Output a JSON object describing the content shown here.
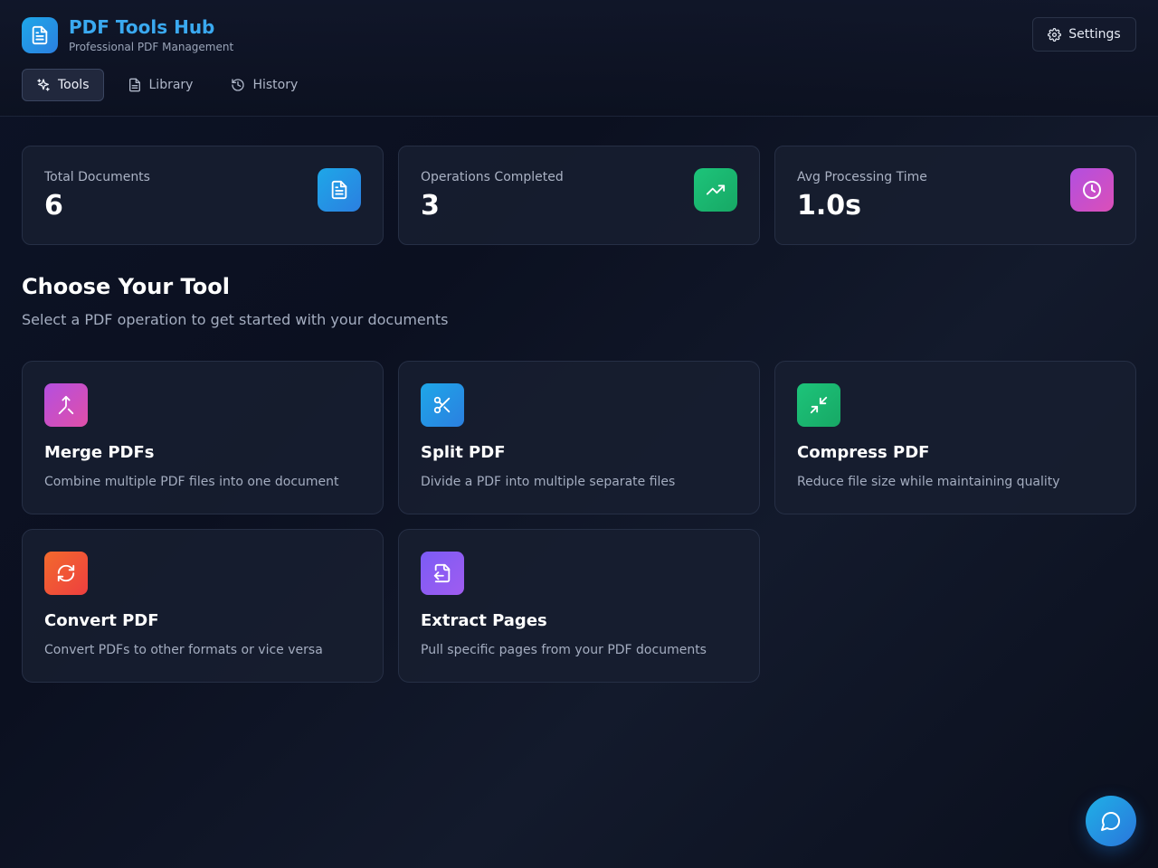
{
  "brand": {
    "title": "PDF Tools Hub",
    "subtitle": "Professional PDF Management",
    "icon": "file-text-icon"
  },
  "header": {
    "settings_label": "Settings"
  },
  "nav": [
    {
      "label": "Tools",
      "icon": "sparkles-icon",
      "active": true
    },
    {
      "label": "Library",
      "icon": "file-icon",
      "active": false
    },
    {
      "label": "History",
      "icon": "history-icon",
      "active": false
    }
  ],
  "stats": [
    {
      "label": "Total Documents",
      "value": "6",
      "icon": "file-text-icon",
      "color": "#2b9fe6"
    },
    {
      "label": "Operations Completed",
      "value": "3",
      "icon": "trending-up-icon",
      "color": "#1dbf73"
    },
    {
      "label": "Avg Processing Time",
      "value": "1.0s",
      "icon": "clock-icon",
      "color": "#c04fd8"
    }
  ],
  "section": {
    "title": "Choose Your Tool",
    "subtitle": "Select a PDF operation to get started with your documents"
  },
  "tools": [
    {
      "title": "Merge PDFs",
      "description": "Combine multiple PDF files into one document",
      "icon": "merge-icon",
      "color": "#c24fd6"
    },
    {
      "title": "Split PDF",
      "description": "Divide a PDF into multiple separate files",
      "icon": "scissors-icon",
      "color": "#2b9fe6"
    },
    {
      "title": "Compress PDF",
      "description": "Reduce file size while maintaining quality",
      "icon": "minimize-icon",
      "color": "#1dbf73"
    },
    {
      "title": "Convert PDF",
      "description": "Convert PDFs to other formats or vice versa",
      "icon": "refresh-icon",
      "color": "#f2542d"
    },
    {
      "title": "Extract Pages",
      "description": "Pull specific pages from your PDF documents",
      "icon": "file-export-icon",
      "color": "#8a5cf5"
    }
  ],
  "chat": {
    "icon": "chat-icon"
  }
}
